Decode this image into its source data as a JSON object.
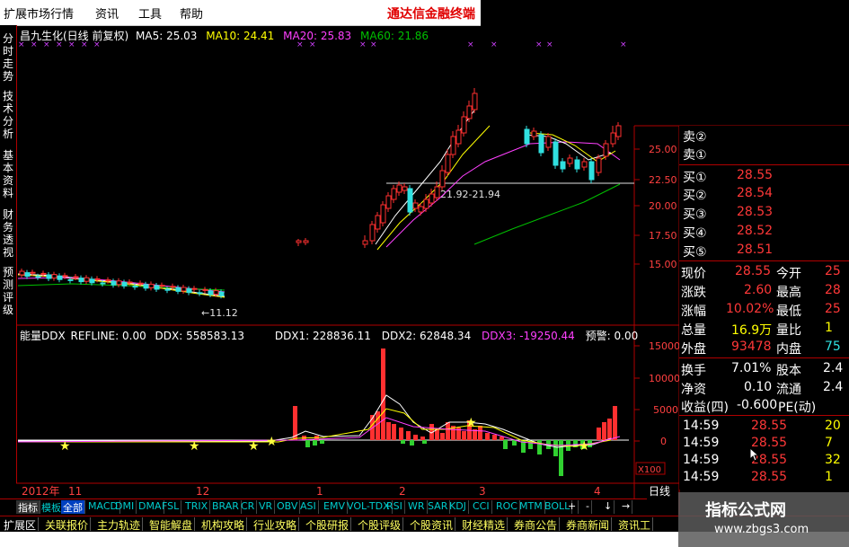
{
  "menu": {
    "items": [
      "扩展市场行情",
      "资讯",
      "工具",
      "帮助"
    ],
    "brand": "通达信金融终端"
  },
  "left_tabs": [
    "分时走势",
    "技术分析",
    "基本资料",
    "财务透视",
    "预测评级"
  ],
  "header": {
    "stock": "昌九生化(日线 前复权)",
    "ma5": "MA5: 25.03",
    "ma10": "MA10: 24.41",
    "ma20": "MA20: 25.83",
    "ma60": "MA60: 21.86"
  },
  "price_axis": [
    "25.00",
    "22.50",
    "20.00",
    "17.50",
    "15.00"
  ],
  "annotations": {
    "low_marker": "←11.12",
    "range_label": "21.92-21.94"
  },
  "ddx_header": {
    "title": "能量DDX",
    "refline": "REFLINE: 0.00",
    "ddx": "DDX: 558583.13",
    "ddx1": "DDX1: 228836.11",
    "ddx2": "DDX2: 62848.34",
    "ddx3": "DDX3: -19250.44",
    "alert": "预警: 0.00"
  },
  "ddx_axis": [
    "15000",
    "10000",
    "5000",
    "0"
  ],
  "ddx_unit": "X100",
  "date_axis": {
    "year": "2012年",
    "marks": [
      "11",
      "12",
      "1",
      "2",
      "3",
      "4"
    ]
  },
  "period": "日线",
  "quote": {
    "sell": [
      {
        "label": "卖②",
        "price": ""
      },
      {
        "label": "卖①",
        "price": ""
      }
    ],
    "buy": [
      {
        "label": "买①",
        "price": "28.55"
      },
      {
        "label": "买②",
        "price": "28.54"
      },
      {
        "label": "买③",
        "price": "28.53"
      },
      {
        "label": "买④",
        "price": "28.52"
      },
      {
        "label": "买⑤",
        "price": "28.51"
      }
    ],
    "stats": [
      {
        "l1": "现价",
        "v1": "28.55",
        "l2": "今开",
        "v2": "25"
      },
      {
        "l1": "涨跌",
        "v1": "2.60",
        "l2": "最高",
        "v2": "28"
      },
      {
        "l1": "涨幅",
        "v1": "10.02%",
        "l2": "最低",
        "v2": "25"
      },
      {
        "l1": "总量",
        "v1": "16.9万",
        "l2": "量比",
        "v2": "1"
      },
      {
        "l1": "外盘",
        "v1": "93478",
        "l2": "内盘",
        "v2": "75"
      }
    ],
    "stats2": [
      {
        "l1": "换手",
        "v1": "7.01%",
        "l2": "股本",
        "v2": "2.4"
      },
      {
        "l1": "净资",
        "v1": "0.10",
        "l2": "流通",
        "v2": "2.4"
      },
      {
        "l1": "收益(四)",
        "v1": "-0.600",
        "l2": "PE(动)",
        "v2": ""
      }
    ],
    "ticks": [
      {
        "time": "14:59",
        "price": "28.55",
        "vol": "20"
      },
      {
        "time": "14:59",
        "price": "28.55",
        "vol": "7"
      },
      {
        "time": "14:59",
        "price": "28.55",
        "vol": "32"
      },
      {
        "time": "14:59",
        "price": "28.55",
        "vol": "1"
      }
    ]
  },
  "indicator_tabs": [
    "指标",
    "模板",
    "全部",
    "MACD",
    "DMI",
    "DMA",
    "FSL",
    "TRIX",
    "BRAR",
    "CR",
    "VR",
    "OBV",
    "ASI",
    "EMV",
    "VOL-TDX",
    "RSI",
    "WR",
    "SAR",
    "KDJ",
    "CCI",
    "ROC",
    "MTM",
    "BOLL"
  ],
  "nav_buttons": [
    "+",
    "-",
    "↓",
    "→"
  ],
  "bottom_tabs": [
    "扩展区",
    "关联报价",
    "主力轨迹",
    "智能解盘",
    "机构攻略",
    "行业攻略",
    "个股研报",
    "个股评级",
    "个股资讯",
    "财经精选",
    "券商公告",
    "券商新闻",
    "资讯工"
  ],
  "watermark": {
    "title": "指标公式网",
    "url": "www.zbgs3.com"
  },
  "colors": {
    "up": "#ff3030",
    "down": "#30e0e0",
    "ma5": "#ffffff",
    "ma10": "#ffff00",
    "ma20": "#ff40ff",
    "ma60": "#00c000"
  }
}
